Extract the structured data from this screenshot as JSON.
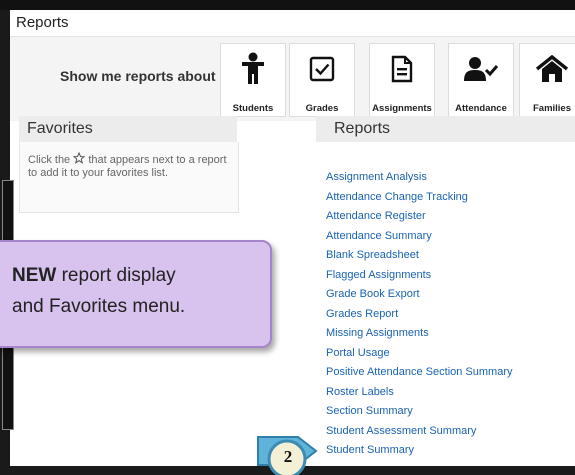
{
  "window": {
    "title": "Reports"
  },
  "toolbar": {
    "show_label": "Show me reports about",
    "categories": [
      {
        "label": "Students",
        "icon": "student-icon"
      },
      {
        "label": "Grades",
        "icon": "checkbox-icon"
      },
      {
        "label": "Assignments",
        "icon": "document-icon"
      },
      {
        "label": "Attendance",
        "icon": "user-check-icon"
      },
      {
        "label": "Families",
        "icon": "home-icon"
      }
    ]
  },
  "favorites": {
    "title": "Favorites",
    "hint_before": "Click the",
    "hint_after": "that appears next to a report to add it to your favorites list."
  },
  "reports": {
    "title": "Reports",
    "items": [
      "Assignment Analysis",
      "Attendance Change Tracking",
      "Attendance Register",
      "Attendance Summary",
      "Blank Spreadsheet",
      "Flagged Assignments",
      "Grade Book Export",
      "Grades Report",
      "Missing Assignments",
      "Portal Usage",
      "Positive Attendance Section Summary",
      "Roster Labels",
      "Section Summary",
      "Student Assessment Summary",
      "Student Summary"
    ]
  },
  "callout": {
    "bold": "NEW",
    "line1_rest": " report display",
    "line2": "and Favorites menu."
  },
  "step_marker": {
    "number": "2"
  },
  "colors": {
    "link": "#1a63b2",
    "callout_bg": "#d7c3ee",
    "step_fill": "#5fb3d8"
  }
}
